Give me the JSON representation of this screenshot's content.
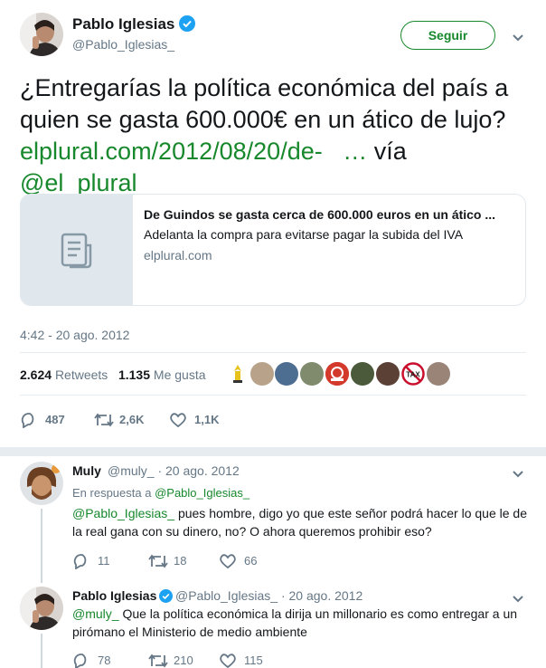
{
  "main_tweet": {
    "author": {
      "name": "Pablo Iglesias",
      "handle": "@Pablo_Iglesias_",
      "verified": true
    },
    "follow_label": "Seguir",
    "text_plain": "¿Entregarías la política económica del país a quien se gasta 600.000€ en un ático de lujo?",
    "link_text": "elplural.com/2012/08/20/de-",
    "link_ellipsis": "…",
    "via_text": "vía",
    "mention": "@el_plural",
    "card": {
      "title": "De Guindos se gasta cerca de 600.000 euros en un ático ...",
      "description": "Adelanta la compra para evitarse pagar la subida del IVA",
      "domain": "elplural.com"
    },
    "timestamp": "4:42 - 20 ago. 2012",
    "stats": {
      "retweets_count": "2.624",
      "retweets_label": "Retweets",
      "likes_count": "1.135",
      "likes_label": "Me gusta"
    },
    "actions": {
      "replies": "487",
      "retweets": "2,6K",
      "likes": "1,1K"
    }
  },
  "replies": [
    {
      "name": "Muly",
      "meta": "@muly_ · 20 ago. 2012",
      "replying_prefix": "En respuesta a",
      "replying_to": "@Pablo_Iglesias_",
      "mention": "@Pablo_Iglesias_",
      "text": " pues hombre, digo yo que este señor podrá hacer lo que le de la real gana con su dinero, no? O ahora queremos prohibir eso?",
      "actions": {
        "replies": "11",
        "retweets": "18",
        "likes": "66"
      }
    },
    {
      "name": "Pablo Iglesias",
      "meta": "@Pablo_Iglesias_ · 20 ago. 2012",
      "mention": "@muly_",
      "text": "  Que la política económica la dirija un millonario es como entregar a un pirómano el Ministerio de medio ambiente",
      "actions": {
        "replies": "78",
        "retweets": "210",
        "likes": "115"
      }
    }
  ],
  "colors": {
    "accent": "#17882c",
    "verified": "#1da1f2",
    "muted": "#657786",
    "divider": "#e6ecf0"
  }
}
